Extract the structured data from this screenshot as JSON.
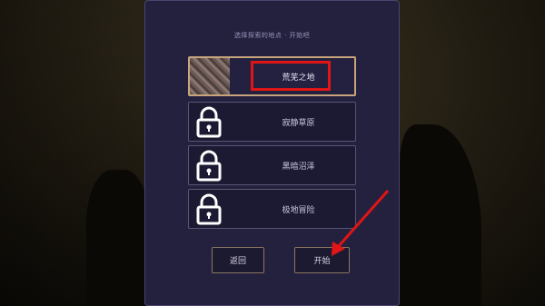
{
  "header": {
    "text": "选择探索的地点 · 开始吧"
  },
  "locations": [
    {
      "label": "荒芜之地",
      "locked": false,
      "selected": true
    },
    {
      "label": "寂静草原",
      "locked": true,
      "selected": false
    },
    {
      "label": "黑暗沼泽",
      "locked": true,
      "selected": false
    },
    {
      "label": "极地冒险",
      "locked": true,
      "selected": false
    }
  ],
  "buttons": {
    "back": "返回",
    "start": "开始"
  },
  "colors": {
    "panel": "#24213f",
    "highlight": "#e01515",
    "selected_border": "#c9a57c"
  }
}
